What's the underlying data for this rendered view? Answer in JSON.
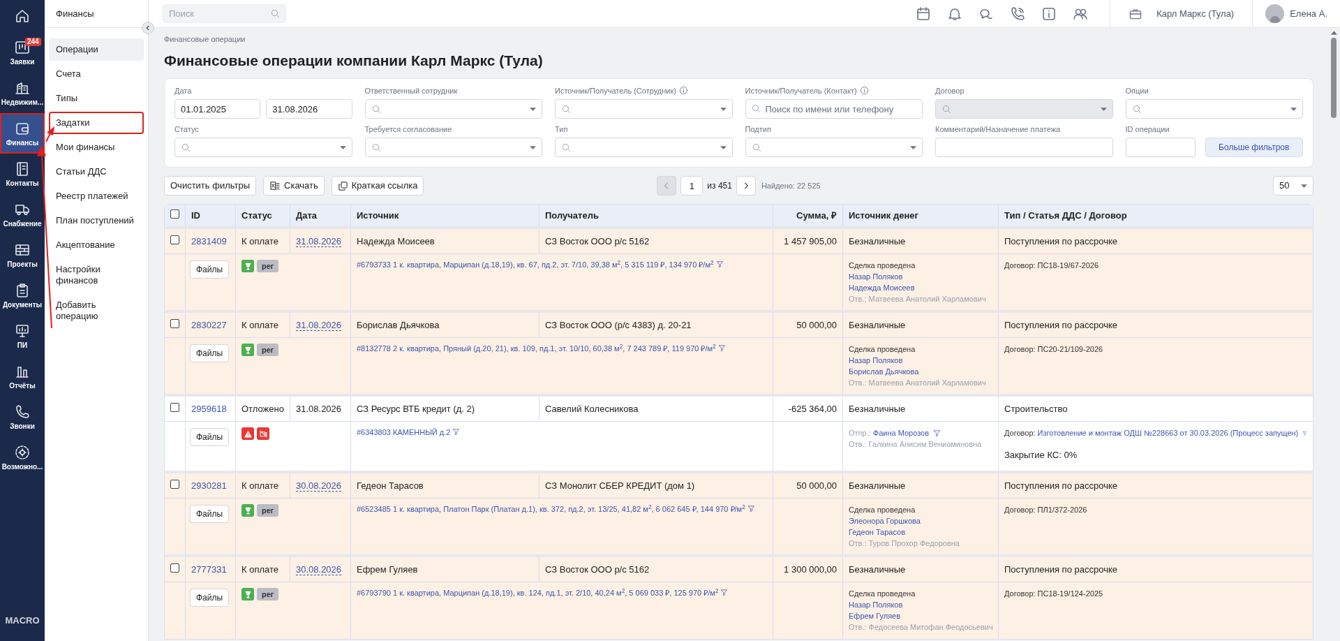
{
  "rail": {
    "items": [
      {
        "kind": "home",
        "selected": false,
        "highlighted": false
      },
      {
        "kind": "board",
        "label": "Заявки",
        "badge": "244",
        "selected": false,
        "highlighted": false
      },
      {
        "kind": "building",
        "label": "Недвижим...",
        "selected": false,
        "highlighted": false
      },
      {
        "kind": "wallet",
        "label": "Финансы",
        "selected": true,
        "highlighted": true
      },
      {
        "kind": "book",
        "label": "Контакты",
        "selected": false,
        "highlighted": false
      },
      {
        "kind": "truck",
        "label": "Снабжение",
        "selected": false,
        "highlighted": false
      },
      {
        "kind": "bricks",
        "label": "Проекты",
        "selected": false,
        "highlighted": false
      },
      {
        "kind": "clipboard",
        "label": "Документы",
        "selected": false,
        "highlighted": false
      },
      {
        "kind": "easel",
        "label": "ПИ",
        "selected": false,
        "highlighted": false
      },
      {
        "kind": "chart",
        "label": "Отчёты",
        "selected": false,
        "highlighted": false
      },
      {
        "kind": "phone",
        "label": "Звонки",
        "selected": false,
        "highlighted": false
      },
      {
        "kind": "gear",
        "label": "Возможно...",
        "selected": false,
        "highlighted": false
      }
    ],
    "brand": "MACRO"
  },
  "sidebar": {
    "title": "Финансы",
    "items": [
      {
        "label": "Операции",
        "selected": true,
        "highlighted": false
      },
      {
        "label": "Счета",
        "selected": false,
        "highlighted": false
      },
      {
        "label": "Типы",
        "selected": false,
        "highlighted": false
      },
      {
        "label": "Задатки",
        "selected": false,
        "highlighted": true
      },
      {
        "label": "Мои финансы",
        "selected": false,
        "highlighted": false
      },
      {
        "label": "Статьи ДДС",
        "selected": false,
        "highlighted": false
      },
      {
        "label": "Реестр платежей",
        "selected": false,
        "highlighted": false
      },
      {
        "label": "План поступлений",
        "selected": false,
        "highlighted": false
      },
      {
        "label": "Акцептование",
        "selected": false,
        "highlighted": false
      },
      {
        "label": "Настройки финансов",
        "selected": false,
        "highlighted": false
      },
      {
        "label": "Добавить операцию",
        "selected": false,
        "highlighted": false
      }
    ]
  },
  "topbar": {
    "search": {
      "placeholder": "Поиск"
    },
    "company": "Карл Маркс (Тула)",
    "user": "Елена А."
  },
  "breadcrumb": "Финансовые операции",
  "title": "Финансовые операции компании Карл Маркс (Тула)",
  "filters": [
    {
      "kind": "date-range",
      "label": "Дата",
      "values": [
        "01.01.2025",
        "31.08.2026"
      ]
    },
    {
      "kind": "select",
      "label": "Ответственный сотрудник"
    },
    {
      "kind": "select",
      "label": "Источник/Получатель (Сотрудник)",
      "info": true
    },
    {
      "kind": "search",
      "label": "Источник/Получатель (Контакт)",
      "info": true,
      "placeholder": "Поиск по имени или телефону"
    },
    {
      "kind": "select",
      "label": "Договор",
      "disabled": true
    },
    {
      "kind": "select",
      "label": "Опции"
    },
    {
      "kind": "select",
      "label": "Статус"
    },
    {
      "kind": "select",
      "label": "Требуется согласование"
    },
    {
      "kind": "select",
      "label": "Тип"
    },
    {
      "kind": "select",
      "label": "Подтип"
    },
    {
      "kind": "text",
      "label": "Комментарий/Назначение платежа"
    },
    {
      "kind": "id",
      "label": "ID операции",
      "button": "Больше фильтров"
    }
  ],
  "toolbar": {
    "buttons": [
      {
        "kind": "plain",
        "label": "Очистить фильтры"
      },
      {
        "kind": "excel",
        "label": "Скачать"
      },
      {
        "kind": "copy",
        "label": "Краткая ссылка"
      }
    ],
    "pagination": {
      "page": "1",
      "of": "из 451",
      "found": "Найдено: 22 525"
    },
    "page_size": "50"
  },
  "table": {
    "select_all": false,
    "columns": [
      "ID",
      "Статус",
      "Дата",
      "Источник",
      "Получатель",
      "Сумма, ₽",
      "Источник денег",
      "Тип / Статья ДДС / Договор"
    ],
    "rows": [
      {
        "highlighted": true,
        "checked": false,
        "id": "2831409",
        "status": "К оплате",
        "date": "31.08.2026",
        "date_link": true,
        "source": "Надежда Моисеев",
        "recipient": "СЗ Восток ООО р/с 5162",
        "amount": "1 457 905,00",
        "money_source": "Безналичные",
        "type": "Поступления по рассрочке",
        "files": "Файлы",
        "badges": [
          {
            "kind": "trophy"
          },
          {
            "kind": "tag",
            "label": "рег"
          }
        ],
        "object": "#6793733 1 к. квартира, Марципан (д.18,19), кв. 67, пд.2, эт. 7/10, 39,38 м$^{2}$, 5 315 119 ₽, 134 970 ₽/м$^{2}$",
        "details": [
          {
            "kind": "status",
            "text": "Сделка проведена"
          },
          {
            "kind": "link",
            "text": "Назар Поляков"
          },
          {
            "kind": "link",
            "text": "Надежда Моисеев"
          },
          {
            "kind": "note",
            "text": "Отв.: Матвеева Анатолий Харламович"
          }
        ],
        "contract": {
          "label": "Договор:",
          "value": "ПС18-19/67-2026",
          "link": false
        }
      },
      {
        "highlighted": true,
        "checked": false,
        "id": "2830227",
        "status": "К оплате",
        "date": "31.08.2026",
        "date_link": true,
        "source": "Борислав Дьячкова",
        "recipient": "СЗ Восток ООО (р/с 4383) д. 20-21",
        "amount": "50 000,00",
        "money_source": "Безналичные",
        "type": "Поступления по рассрочке",
        "files": "Файлы",
        "badges": [
          {
            "kind": "trophy"
          },
          {
            "kind": "tag",
            "label": "рег"
          }
        ],
        "object": "#8132778 2 к. квартира, Пряный (д.20, 21), кв. 109, пд.1, эт. 10/10, 60,38 м$^{2}$, 7 243 789 ₽, 119 970 ₽/м$^{2}$",
        "details": [
          {
            "kind": "status",
            "text": "Сделка проведена"
          },
          {
            "kind": "link",
            "text": "Назар Поляков"
          },
          {
            "kind": "link",
            "text": "Борислав Дьячкова"
          },
          {
            "kind": "note",
            "text": "Отв.: Матвеева Анатолий Харламович"
          }
        ],
        "contract": {
          "label": "Договор:",
          "value": "ПС20-21/109-2026",
          "link": false
        }
      },
      {
        "highlighted": false,
        "checked": false,
        "id": "2959618",
        "status": "Отложено",
        "date": "31.08.2026",
        "date_link": false,
        "source": "СЗ Ресурс ВТБ кредит (д. 2)",
        "recipient": "Савелий Колесникова",
        "amount": "-625 364,00",
        "money_source": "Безналичные",
        "type": "Строительство",
        "files": "Файлы",
        "badges": [
          {
            "kind": "warning"
          },
          {
            "kind": "blocked"
          }
        ],
        "object": "#6343803 КАМЕННЫЙ д.2",
        "details": [
          {
            "kind": "sender",
            "label": "Отпр.:",
            "text": "Фаина Морозов"
          },
          {
            "kind": "note",
            "text": "Отв.: Галкина Анисим Вениаминовна"
          }
        ],
        "contract": {
          "label": "Договор:",
          "value": "Изготовление и монтаж ОДШ №228663 от 30.03.2026 (Процесс запущен)",
          "link": true
        },
        "closing": "Закрытие КС: 0%"
      },
      {
        "highlighted": true,
        "checked": false,
        "id": "2930281",
        "status": "К оплате",
        "date": "30.08.2026",
        "date_link": true,
        "source": "Гедеон Тарасов",
        "recipient": "СЗ Монолит СБЕР КРЕДИТ (дом 1)",
        "amount": "50 000,00",
        "money_source": "Безналичные",
        "type": "Поступления по рассрочке",
        "files": "Файлы",
        "badges": [
          {
            "kind": "trophy"
          },
          {
            "kind": "tag",
            "label": "рег"
          }
        ],
        "object": "#6523485 1 к. квартира, Платон Парк (Платан д.1), кв. 372, пд.2, эт. 13/25, 41,82 м$^{2}$, 6 062 645 ₽, 144 970 ₽/м$^{2}$",
        "details": [
          {
            "kind": "status",
            "text": "Сделка проведена"
          },
          {
            "kind": "link",
            "text": "Элеонора Горшкова"
          },
          {
            "kind": "link",
            "text": "Гедеон Тарасов"
          },
          {
            "kind": "note",
            "text": "Отв.: Туров Прохор Федоровна"
          }
        ],
        "contract": {
          "label": "Договор:",
          "value": "ПЛ1/372-2026",
          "link": false
        }
      },
      {
        "highlighted": true,
        "checked": false,
        "id": "2777331",
        "status": "К оплате",
        "date": "30.08.2026",
        "date_link": true,
        "source": "Ефрем Гуляев",
        "recipient": "СЗ Восток ООО р/с 5162",
        "amount": "1 300 000,00",
        "money_source": "Безналичные",
        "type": "Поступления по рассрочке",
        "files": "Файлы",
        "badges": [
          {
            "kind": "trophy"
          },
          {
            "kind": "tag",
            "label": "рег"
          }
        ],
        "object": "#6793790 1 к. квартира, Марципан (д.18,19), кв. 124, пд.1, эт. 2/10, 40,24 м$^{2}$, 5 069 033 ₽, 125 970 ₽/м$^{2}$",
        "details": [
          {
            "kind": "status",
            "text": "Сделка проведена"
          },
          {
            "kind": "link",
            "text": "Назар Поляков"
          },
          {
            "kind": "link",
            "text": "Ефрем Гуляев"
          },
          {
            "kind": "note",
            "text": "Отв.: Федосеева Митофан Феодосьевич"
          }
        ],
        "contract": {
          "label": "Договор:",
          "value": "ПС18-19/124-2025",
          "link": false
        }
      }
    ]
  }
}
